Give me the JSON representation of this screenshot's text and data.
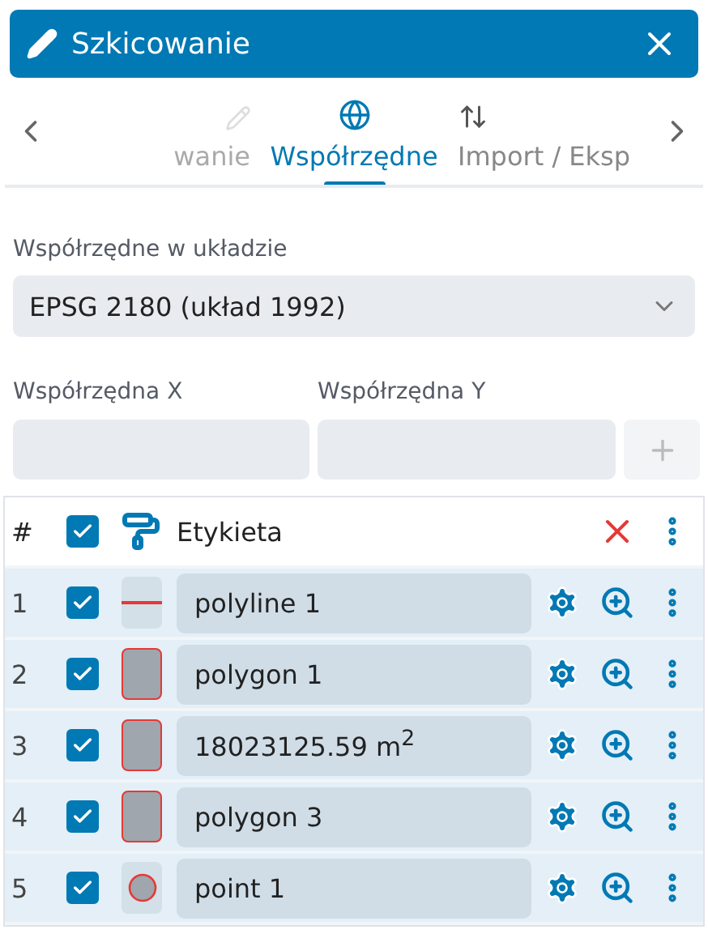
{
  "header": {
    "title": "Szkicowanie"
  },
  "tabs": [
    {
      "label": "wanie",
      "selected": false
    },
    {
      "label": "Współrzędne",
      "selected": true
    },
    {
      "label": "Import / Eksp",
      "selected": false
    }
  ],
  "crs": {
    "label": "Współrzędne w układzie",
    "value": "EPSG 2180 (układ 1992)"
  },
  "coords": {
    "x_label": "Współrzędna X",
    "y_label": "Współrzędna Y",
    "add_disabled": true
  },
  "table": {
    "columns": {
      "index": "#",
      "label": "Etykieta"
    },
    "all_checked": true,
    "rows": [
      {
        "index": "1",
        "checked": true,
        "kind": "line",
        "label": "polyline 1"
      },
      {
        "index": "2",
        "checked": true,
        "kind": "polygon",
        "label": "polygon 1"
      },
      {
        "index": "3",
        "checked": true,
        "kind": "polygon",
        "label": "18023125.59 m$^{2}$"
      },
      {
        "index": "4",
        "checked": true,
        "kind": "polygon",
        "label": "polygon 3"
      },
      {
        "index": "5",
        "checked": true,
        "kind": "point",
        "label": "point 1"
      }
    ]
  }
}
